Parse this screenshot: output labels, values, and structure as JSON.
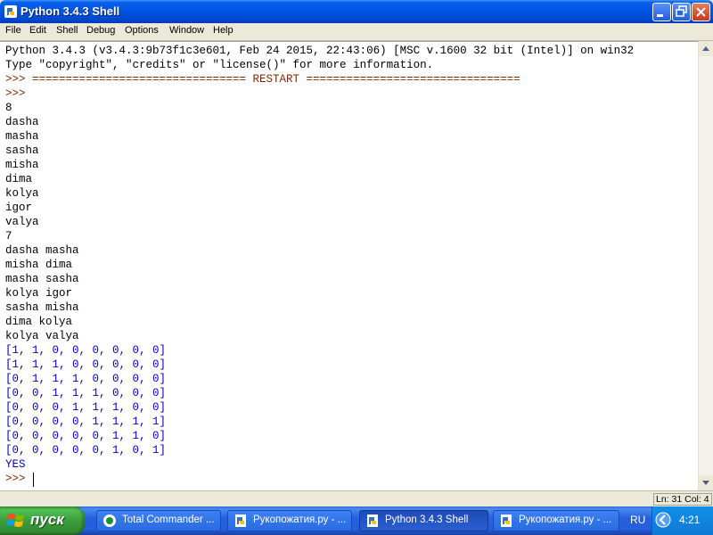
{
  "window": {
    "title": "Python 3.4.3 Shell"
  },
  "menu": [
    "File",
    "Edit",
    "Shell",
    "Debug",
    "Options",
    "Window",
    "Help"
  ],
  "shell": {
    "lines": [
      {
        "text": "Python 3.4.3 (v3.4.3:9b73f1c3e601, Feb 24 2015, 22:43:06) [MSC v.1600 32 bit (Intel)] on win32",
        "kind": "black"
      },
      {
        "text": "Type \"copyright\", \"credits\" or \"license()\" for more information.",
        "kind": "black"
      },
      {
        "text": ">>> ================================ RESTART ================================",
        "kind": "prompt"
      },
      {
        "text": ">>> ",
        "kind": "prompt"
      },
      {
        "text": "8",
        "kind": "black"
      },
      {
        "text": "dasha",
        "kind": "black"
      },
      {
        "text": "masha",
        "kind": "black"
      },
      {
        "text": "sasha",
        "kind": "black"
      },
      {
        "text": "misha",
        "kind": "black"
      },
      {
        "text": "dima",
        "kind": "black"
      },
      {
        "text": "kolya",
        "kind": "black"
      },
      {
        "text": "igor",
        "kind": "black"
      },
      {
        "text": "valya",
        "kind": "black"
      },
      {
        "text": "7",
        "kind": "black"
      },
      {
        "text": "dasha masha",
        "kind": "black"
      },
      {
        "text": "misha dima",
        "kind": "black"
      },
      {
        "text": "masha sasha",
        "kind": "black"
      },
      {
        "text": "kolya igor",
        "kind": "black"
      },
      {
        "text": "sasha misha",
        "kind": "black"
      },
      {
        "text": "dima kolya",
        "kind": "black"
      },
      {
        "text": "kolya valya",
        "kind": "black"
      },
      {
        "text": "[1, 1, 0, 0, 0, 0, 0, 0]",
        "kind": "blue"
      },
      {
        "text": "[1, 1, 1, 0, 0, 0, 0, 0]",
        "kind": "blue"
      },
      {
        "text": "[0, 1, 1, 1, 0, 0, 0, 0]",
        "kind": "blue"
      },
      {
        "text": "[0, 0, 1, 1, 1, 0, 0, 0]",
        "kind": "blue"
      },
      {
        "text": "[0, 0, 0, 1, 1, 1, 0, 0]",
        "kind": "blue"
      },
      {
        "text": "[0, 0, 0, 0, 1, 1, 1, 1]",
        "kind": "blue"
      },
      {
        "text": "[0, 0, 0, 0, 0, 1, 1, 0]",
        "kind": "blue"
      },
      {
        "text": "[0, 0, 0, 0, 0, 1, 0, 1]",
        "kind": "blue"
      },
      {
        "text": "YES",
        "kind": "blue"
      },
      {
        "text": ">>> ",
        "kind": "prompt"
      }
    ]
  },
  "status": {
    "text": "Ln: 31  Col: 4"
  },
  "taskbar": {
    "start_label": "пуск",
    "tasks": [
      {
        "label": "Total Commander ..."
      },
      {
        "label": "Рукопожатия.ру - ..."
      },
      {
        "label": "Python 3.4.3 Shell"
      },
      {
        "label": "Рукопожатия.ру - ..."
      }
    ],
    "lang": "RU",
    "clock": "4:21"
  },
  "colors": {
    "title_blue": "#0055E5",
    "output_blue": "#0000C0",
    "prompt": "#7A2A00",
    "start_green": "#3A9D3A"
  }
}
